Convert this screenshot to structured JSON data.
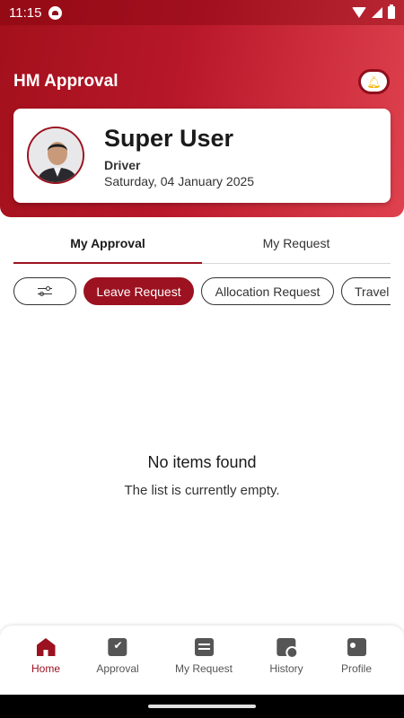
{
  "status_bar": {
    "time": "11:15"
  },
  "header": {
    "title": "HM Approval"
  },
  "profile": {
    "name": "Super User",
    "role": "Driver",
    "date": "Saturday, 04 January 2025"
  },
  "tabs": [
    {
      "label": "My Approval",
      "active": true
    },
    {
      "label": "My Request",
      "active": false
    }
  ],
  "filters": {
    "chips": [
      {
        "label": "Leave Request",
        "active": true
      },
      {
        "label": "Allocation Request",
        "active": false
      },
      {
        "label": "Travel",
        "active": false
      }
    ]
  },
  "empty_state": {
    "title": "No items found",
    "subtitle": "The list is currently empty."
  },
  "bottom_nav": {
    "items": [
      {
        "label": "Home",
        "icon": "home-icon",
        "active": true
      },
      {
        "label": "Approval",
        "icon": "approval-icon"
      },
      {
        "label": "My Request",
        "icon": "my-request-icon"
      },
      {
        "label": "History",
        "icon": "history-icon"
      },
      {
        "label": "Profile",
        "icon": "profile-icon"
      }
    ]
  },
  "colors": {
    "primary": "#9c1220",
    "header_gradient_end": "#e0414e",
    "bell": "#f5b400"
  }
}
